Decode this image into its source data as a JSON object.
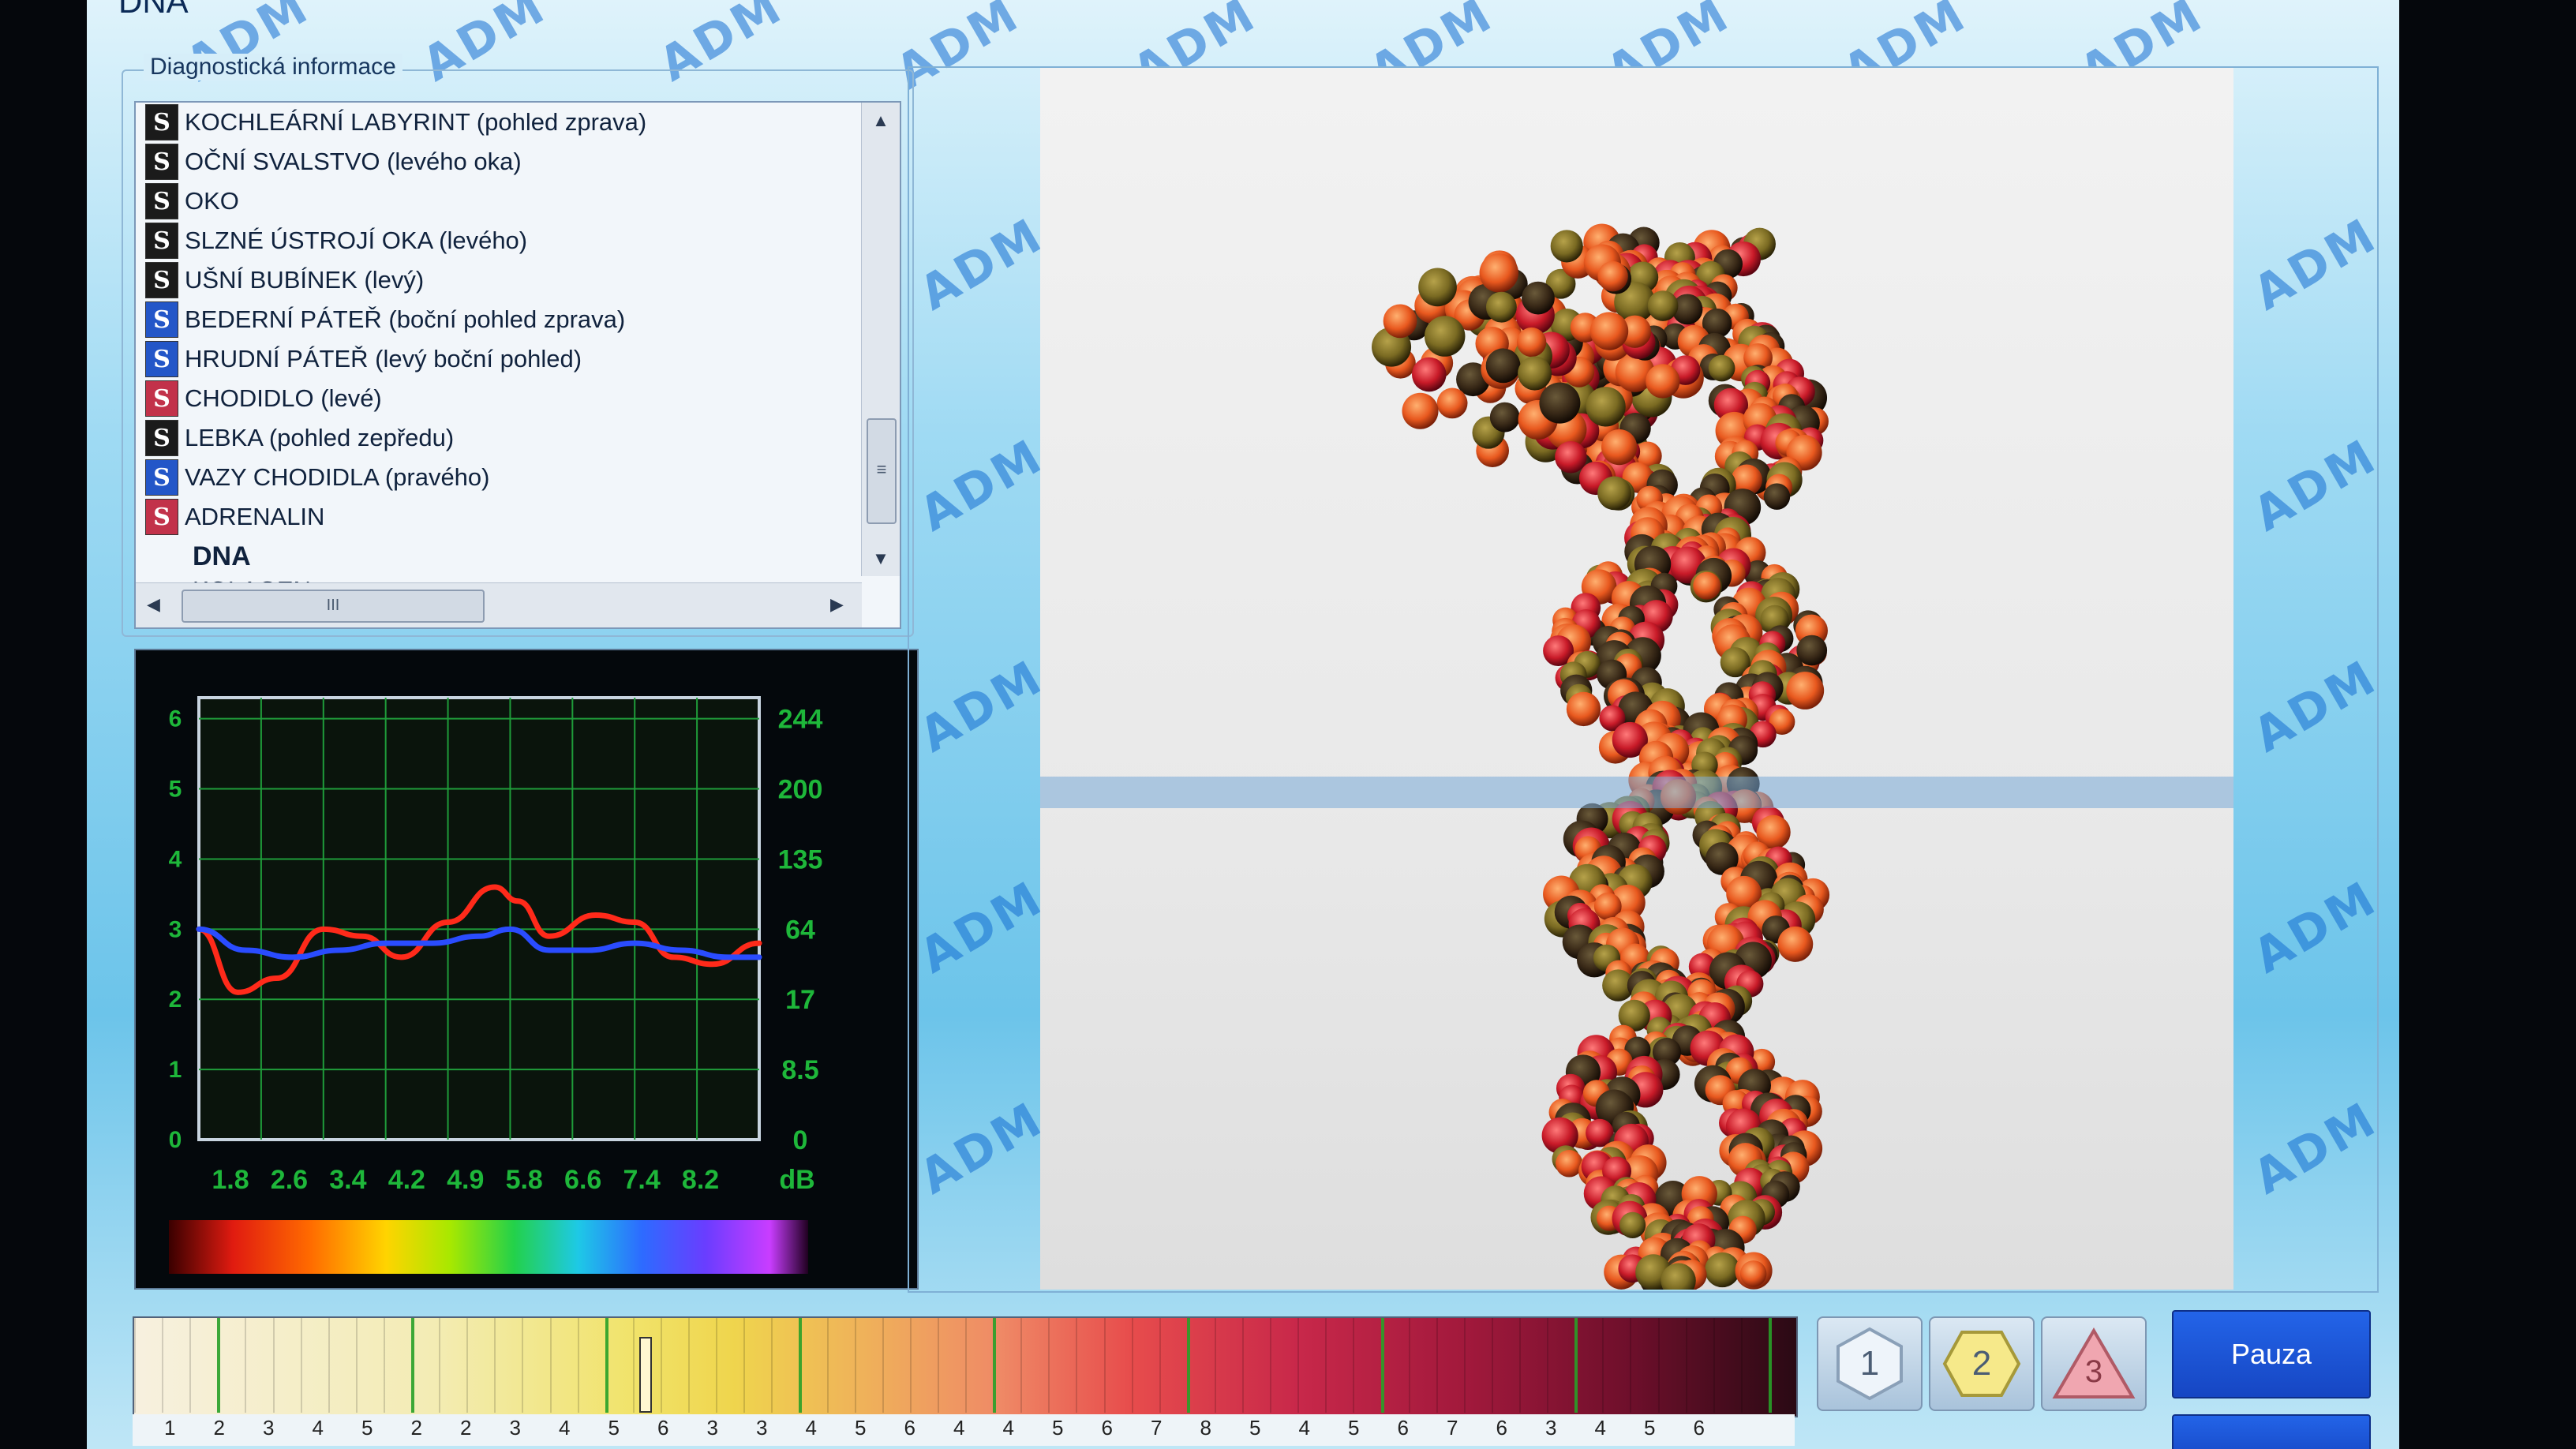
{
  "window": {
    "title": "DNA"
  },
  "diagnostics": {
    "group_label": "Diagnostická informace",
    "items": [
      {
        "label": "KOCHLEÁRNÍ LABYRINT (pohled zprava)",
        "badge": "S",
        "badge_color": "#1b1b1b"
      },
      {
        "label": "OČNÍ SVALSTVO (levého oka)",
        "badge": "S",
        "badge_color": "#1b1b1b"
      },
      {
        "label": "OKO",
        "badge": "S",
        "badge_color": "#1b1b1b"
      },
      {
        "label": "SLZNÉ ÚSTROJÍ OKA (levého)",
        "badge": "S",
        "badge_color": "#1b1b1b"
      },
      {
        "label": "UŠNÍ BUBÍNEK (levý)",
        "badge": "S",
        "badge_color": "#1b1b1b"
      },
      {
        "label": "BEDERNÍ PÁTEŘ (boční pohled zprava)",
        "badge": "S",
        "badge_color": "#2356c8"
      },
      {
        "label": "HRUDNÍ PÁTEŘ (levý boční pohled)",
        "badge": "S",
        "badge_color": "#2356c8"
      },
      {
        "label": "CHODIDLO (levé)",
        "badge": "S",
        "badge_color": "#c2324a"
      },
      {
        "label": "LEBKA (pohled zepředu)",
        "badge": "S",
        "badge_color": "#1b1b1b"
      },
      {
        "label": "VAZY CHODIDLA (pravého)",
        "badge": "S",
        "badge_color": "#2356c8"
      },
      {
        "label": "ADRENALIN",
        "badge": "S",
        "badge_color": "#c2324a"
      },
      {
        "label": "DNA",
        "badge": "",
        "selected": true
      },
      {
        "label": "KOLAGEN",
        "badge": ""
      }
    ],
    "vscroll_grip": "≡",
    "hscroll_grip": "III",
    "arrows": {
      "up": "▲",
      "down": "▼",
      "left": "◀",
      "right": "▶"
    }
  },
  "chart_data": {
    "type": "line",
    "x_tick_labels": [
      "1.8",
      "2.6",
      "3.4",
      "4.2",
      "4.9",
      "5.8",
      "6.6",
      "7.4",
      "8.2"
    ],
    "x_unit": "dB",
    "y_left_ticks": [
      "0",
      "1",
      "2",
      "3",
      "4",
      "5",
      "6"
    ],
    "y_right_ticks": [
      "0",
      "8.5",
      "17",
      "64",
      "135",
      "200",
      "244"
    ],
    "ylim": [
      0,
      6.3
    ],
    "xlim": [
      1.0,
      8.2
    ],
    "grid": true,
    "series": [
      {
        "color": "#ff2a1a",
        "x": [
          1.0,
          1.5,
          2.0,
          2.6,
          3.1,
          3.6,
          4.2,
          4.8,
          5.1,
          5.5,
          6.1,
          6.6,
          7.1,
          7.6,
          8.2
        ],
        "y": [
          3.0,
          2.1,
          2.3,
          3.0,
          2.9,
          2.6,
          3.1,
          3.6,
          3.4,
          2.9,
          3.2,
          3.1,
          2.6,
          2.5,
          2.8
        ]
      },
      {
        "color": "#2a4cff",
        "x": [
          1.0,
          1.6,
          2.2,
          2.8,
          3.4,
          4.0,
          4.6,
          5.0,
          5.5,
          6.0,
          6.6,
          7.2,
          7.8,
          8.2
        ],
        "y": [
          3.0,
          2.7,
          2.6,
          2.7,
          2.8,
          2.8,
          2.9,
          3.0,
          2.7,
          2.7,
          2.8,
          2.7,
          2.6,
          2.6
        ]
      }
    ]
  },
  "scale": {
    "numbers": [
      "1",
      "2",
      "3",
      "4",
      "5",
      "2",
      "2",
      "3",
      "4",
      "5",
      "6",
      "3",
      "3",
      "4",
      "5",
      "6",
      "4",
      "4",
      "5",
      "6",
      "7",
      "8",
      "5",
      "4",
      "5",
      "6",
      "7",
      "6",
      "3",
      "4",
      "5",
      "6"
    ],
    "cursor_fraction": 0.305
  },
  "tools": {
    "btn1": "1",
    "btn2": "2",
    "btn3": "3"
  },
  "controls": {
    "pause_label": "Pauza"
  },
  "watermark_text": "ADM"
}
